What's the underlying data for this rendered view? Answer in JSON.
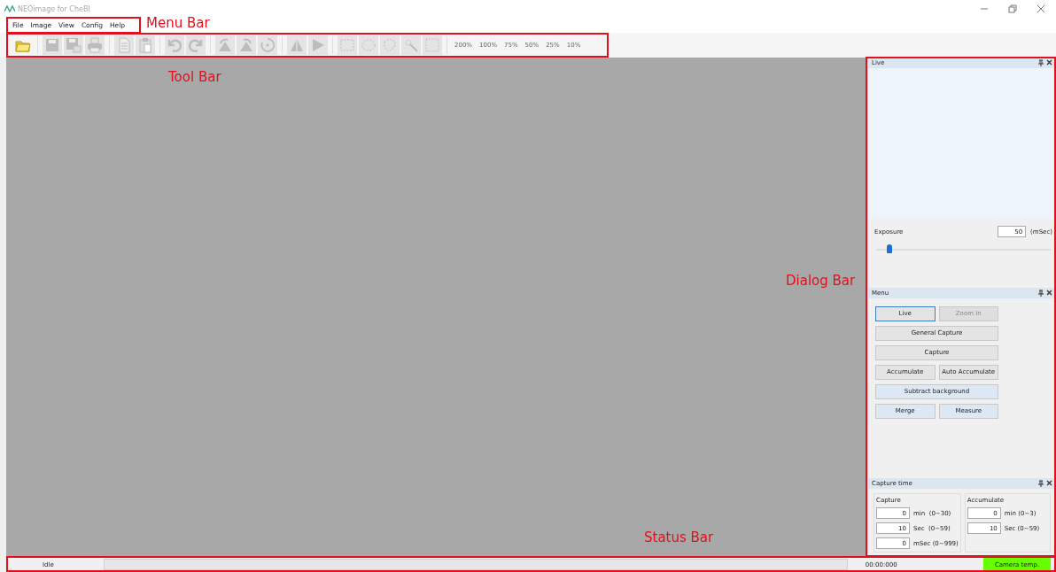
{
  "window": {
    "title": "NEOimage for CheBI"
  },
  "menu_bar": [
    "File",
    "Image",
    "View",
    "Config",
    "Help"
  ],
  "toolbar": {
    "tools": [
      {
        "kind": "open",
        "disabled": false
      },
      {
        "kind": "save",
        "disabled": true
      },
      {
        "kind": "save-as",
        "disabled": true
      },
      {
        "kind": "print",
        "disabled": true
      },
      {
        "kind": "copy",
        "disabled": true
      },
      {
        "kind": "paste",
        "disabled": true
      },
      {
        "kind": "undo",
        "disabled": true
      },
      {
        "kind": "redo",
        "disabled": true
      },
      {
        "kind": "rotate-left",
        "disabled": true
      },
      {
        "kind": "rotate-right",
        "disabled": true
      },
      {
        "kind": "rotate",
        "disabled": true
      },
      {
        "kind": "flip-up",
        "disabled": true
      },
      {
        "kind": "flip-right",
        "disabled": true
      },
      {
        "kind": "rect-select",
        "disabled": true
      },
      {
        "kind": "ellipse-select",
        "disabled": true
      },
      {
        "kind": "lasso-select",
        "disabled": true
      },
      {
        "kind": "magic-wand",
        "disabled": true
      },
      {
        "kind": "select-none",
        "disabled": true
      }
    ],
    "zoom_levels": [
      "200%",
      "100%",
      "75%",
      "50%",
      "25%",
      "10%"
    ]
  },
  "live_panel": {
    "title": "Live",
    "exposure": {
      "label": "Exposure",
      "value": "50",
      "unit": "(mSec)",
      "level": 0.06
    }
  },
  "menu_panel": {
    "title": "Menu",
    "rows": [
      [
        {
          "label": "Live",
          "selected": true,
          "disabled": false,
          "highlighted": false
        },
        {
          "label": "Zoom In",
          "selected": false,
          "disabled": true,
          "highlighted": false
        }
      ],
      [
        {
          "label": "General Capture",
          "selected": false,
          "disabled": false,
          "highlighted": false
        }
      ],
      [
        {
          "label": "Capture",
          "selected": false,
          "disabled": false,
          "highlighted": false
        }
      ],
      [
        {
          "label": "Accumulate",
          "selected": false,
          "disabled": false,
          "highlighted": false
        },
        {
          "label": "Auto Accumulate",
          "selected": false,
          "disabled": false,
          "highlighted": false
        }
      ],
      [
        {
          "label": "Subtract background",
          "selected": false,
          "disabled": false,
          "highlighted": true
        }
      ],
      [
        {
          "label": "Merge",
          "selected": false,
          "disabled": false,
          "highlighted": true
        },
        {
          "label": "Measure",
          "selected": false,
          "disabled": false,
          "highlighted": true
        }
      ]
    ]
  },
  "capture_time_panel": {
    "title": "Capture time",
    "groups": [
      {
        "title": "Capture",
        "fields": [
          {
            "value": "0",
            "unit": "min  (0~30)"
          },
          {
            "value": "10",
            "unit": "Sec  (0~59)"
          },
          {
            "value": "0",
            "unit": "mSec (0~999)"
          }
        ]
      },
      {
        "title": "Accumulate",
        "fields": [
          {
            "value": "0",
            "unit": "min (0~3)"
          },
          {
            "value": "10",
            "unit": "Sec (0~59)"
          }
        ]
      }
    ]
  },
  "status_bar": {
    "status": "Idle",
    "time": "00:00:000",
    "camera_temp": "Camera temp."
  },
  "annotations": [
    {
      "kind": "menu",
      "label": "Menu Bar"
    },
    {
      "kind": "tool",
      "label": "Tool Bar"
    },
    {
      "kind": "dialog",
      "label": "Dialog Bar"
    },
    {
      "kind": "status",
      "label": "Status Bar"
    }
  ]
}
